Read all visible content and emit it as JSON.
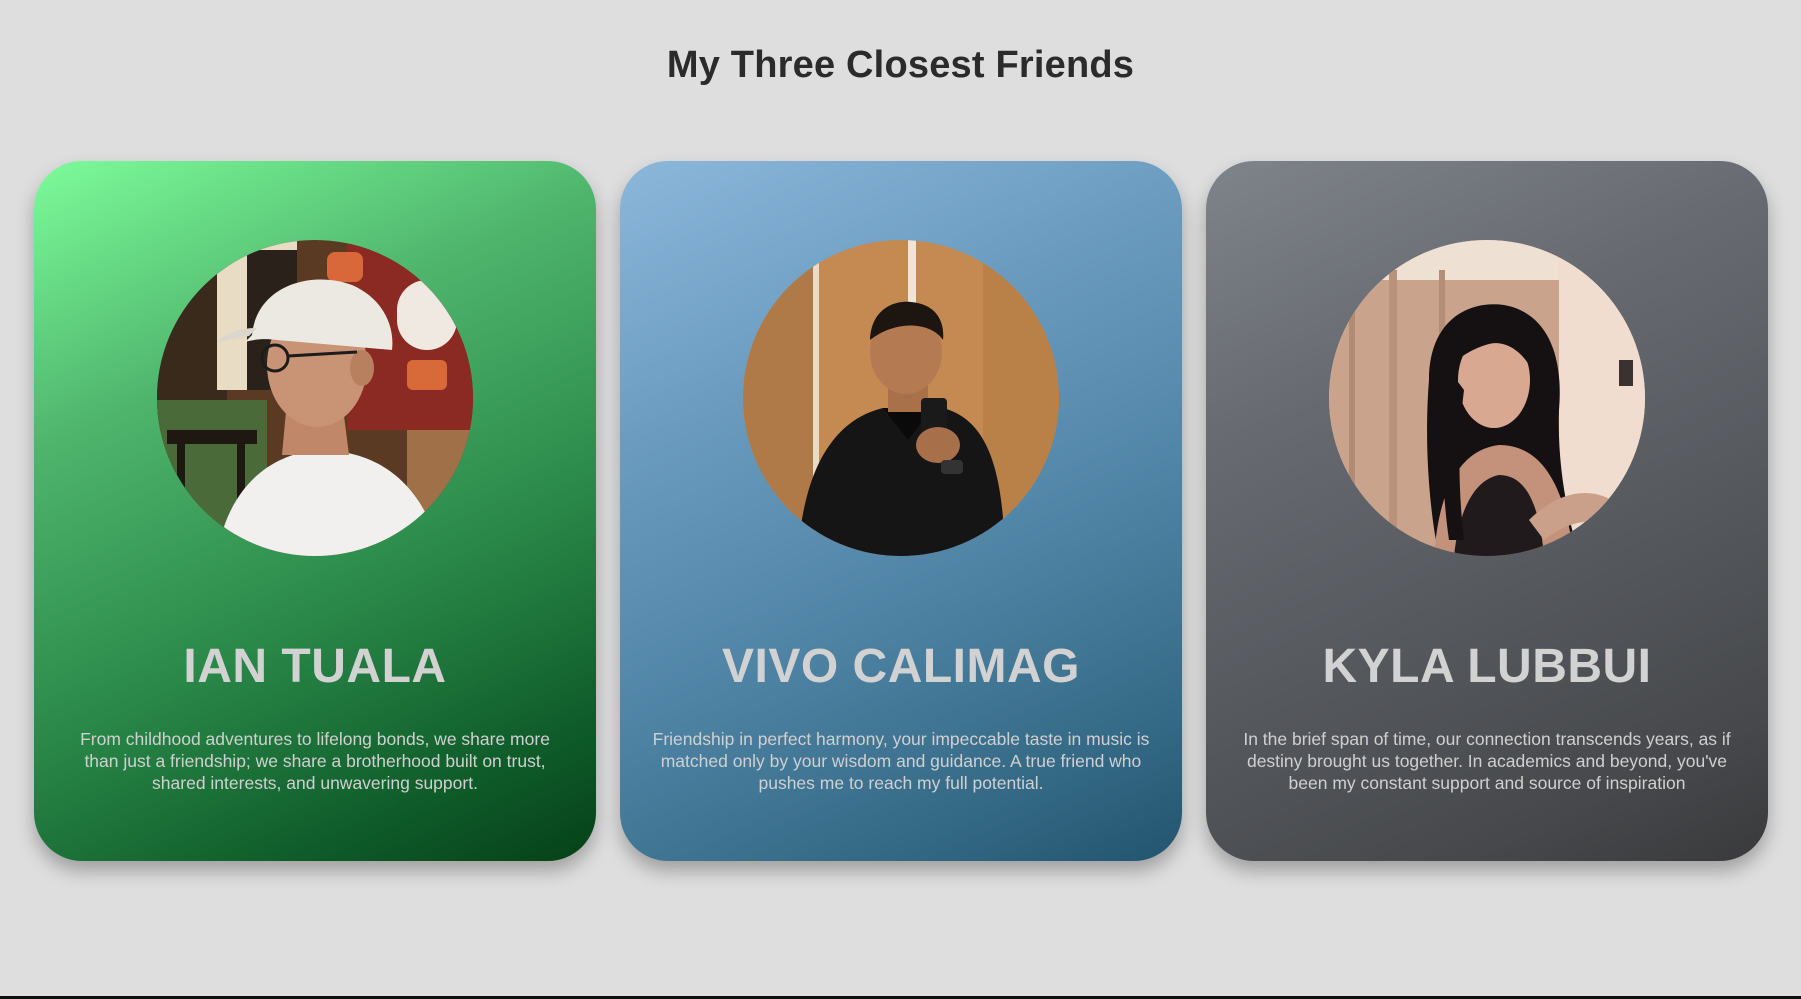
{
  "page": {
    "title": "My Three Closest Friends",
    "background": "#dedede"
  },
  "friends": [
    {
      "name": "IAN TUALA",
      "description": "From childhood adventures to lifelong bonds, we share more than just a friendship; we share a brotherhood built on trust, shared interests, and unwavering support.",
      "photo": "profile-photo-man-white-cap-glasses",
      "gradient": [
        "#7dfb9a",
        "#064018"
      ]
    },
    {
      "name": "VIVO CALIMAG",
      "description": "Friendship in perfect harmony, your impeccable taste in music is matched only by your wisdom and guidance. A true friend who pushes me to reach my full potential.",
      "photo": "profile-photo-man-black-polo-mirror-selfie",
      "gradient": [
        "#8bb7da",
        "#22546e"
      ]
    },
    {
      "name": "KYLA LUBBUI",
      "description": "In the brief span of time, our connection transcends years, as if destiny brought us together. In academics and beyond, you've been my constant support and source of inspiration",
      "photo": "profile-photo-woman-long-dark-hair",
      "gradient": [
        "#7f848a",
        "#3a3a3c"
      ]
    }
  ]
}
